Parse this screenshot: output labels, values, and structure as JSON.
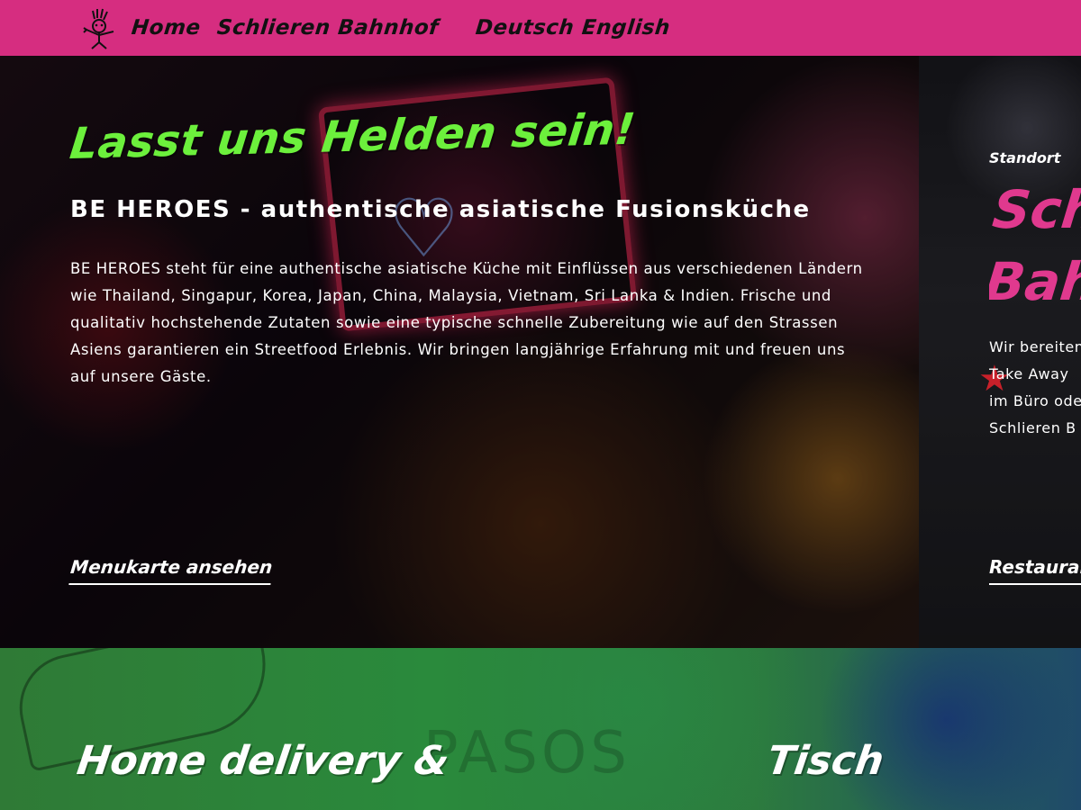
{
  "nav": {
    "logo_icon": "hero-mascot-logo",
    "home": "Home",
    "location": "Schlieren Bahnhof",
    "lang_de": "Deutsch",
    "lang_en": "English",
    "bar_color": "#d62d80"
  },
  "hero": {
    "headline": "Lasst uns Helden sein!",
    "subtitle": "BE HEROES - authentische asiatische Fusionsküche",
    "text": "BE HEROES steht für eine authentische asiatische Küche mit Einflüssen aus verschiedenen Ländern wie Thailand, Singapur, Korea, Japan, China, Malaysia, Vietnam, Sri Lanka & Indien. Frische und qualitativ hochstehende Zutaten sowie eine typische schnelle Zubereitung wie auf den Strassen Asiens garantieren ein Streetfood Erlebnis. Wir bringen langjährige Erfahrung mit und freuen uns auf unsere Gäste.",
    "link": "Menukarte ansehen",
    "headline_color": "#6cf03c"
  },
  "standort": {
    "label": "Standort",
    "title_line1": "Schlieren",
    "title_line2": "Bahnhof",
    "text_line1": "Wir bereiten",
    "text_line2": "Take Away",
    "text_line3": "im Büro oder",
    "text_line4": "Schlieren B",
    "link": "Restaurant",
    "title_color": "#e0398e"
  },
  "bottom": {
    "title_left": "Home delivery &",
    "title_right": "Tisch",
    "bg_text": "PASOS"
  }
}
